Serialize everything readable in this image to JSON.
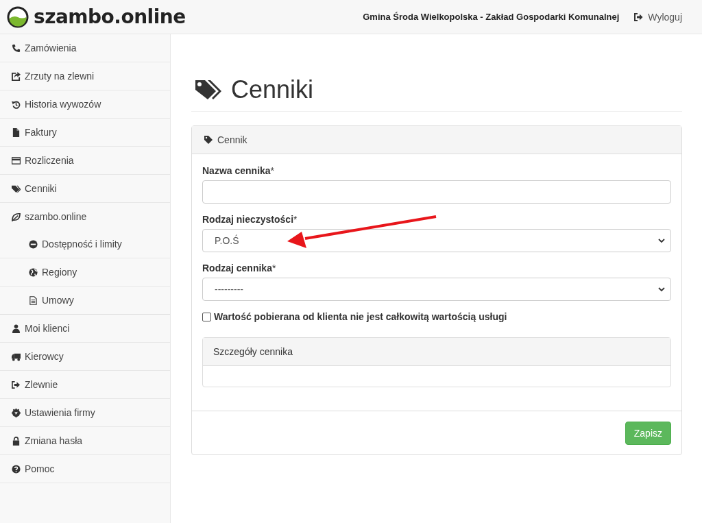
{
  "header": {
    "brand": "szambo.online",
    "organization": "Gmina Środa Wielkopolska - Zakład Gospodarki Komunalnej",
    "logout": "Wyloguj"
  },
  "sidebar": {
    "items": [
      {
        "label": "Zamówienia"
      },
      {
        "label": "Zrzuty na zlewni"
      },
      {
        "label": "Historia wywozów"
      },
      {
        "label": "Faktury"
      },
      {
        "label": "Rozliczenia"
      },
      {
        "label": "Cenniki"
      },
      {
        "label": "szambo.online",
        "children": [
          {
            "label": "Dostępność i limity"
          },
          {
            "label": "Regiony"
          },
          {
            "label": "Umowy"
          }
        ]
      },
      {
        "label": "Moi klienci"
      },
      {
        "label": "Kierowcy"
      },
      {
        "label": "Zlewnie"
      },
      {
        "label": "Ustawienia firmy"
      },
      {
        "label": "Zmiana hasła"
      },
      {
        "label": "Pomoc"
      }
    ]
  },
  "page": {
    "title": "Cenniki"
  },
  "panel": {
    "title": "Cennik",
    "fields": [
      {
        "kind": "text",
        "label": "Nazwa cennika",
        "required_mark": "*"
      },
      {
        "kind": "select",
        "label": "Rodzaj nieczystości",
        "required_mark": "*",
        "value": "P.O.Ś"
      },
      {
        "kind": "select",
        "label": "Rodzaj cennika",
        "required_mark": "*",
        "value": "---------"
      }
    ],
    "checkbox": {
      "label": "Wartość pobierana od klienta nie jest całkowitą wartością usługi",
      "checked": false
    },
    "details": {
      "title": "Szczegóły cennika"
    },
    "submit": "Zapisz"
  }
}
